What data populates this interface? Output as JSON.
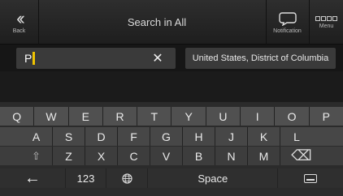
{
  "header": {
    "back_icon": "double-chevron-left-icon",
    "back_label": "Back",
    "title": "Search in All",
    "notification_icon": "speech-bubble-icon",
    "notification_label": "Notification",
    "menu_icon": "menu-grid-icon",
    "menu_label": "Menu"
  },
  "search": {
    "value": "P",
    "clear_icon": "close-icon",
    "country": "United States, District of Columbia"
  },
  "keyboard": {
    "row1": [
      "Q",
      "W",
      "E",
      "R",
      "T",
      "Y",
      "U",
      "I",
      "O",
      "P"
    ],
    "row2": [
      "A",
      "S",
      "D",
      "F",
      "G",
      "H",
      "J",
      "K",
      "L"
    ],
    "row3": {
      "shift_icon": "⇧",
      "keys": [
        "Z",
        "X",
        "C",
        "V",
        "B",
        "N",
        "M"
      ],
      "backspace_icon": "⌫"
    },
    "row4": {
      "left_arrow": "←",
      "numbers": "123",
      "globe": "🌐",
      "space": "Space"
    }
  }
}
